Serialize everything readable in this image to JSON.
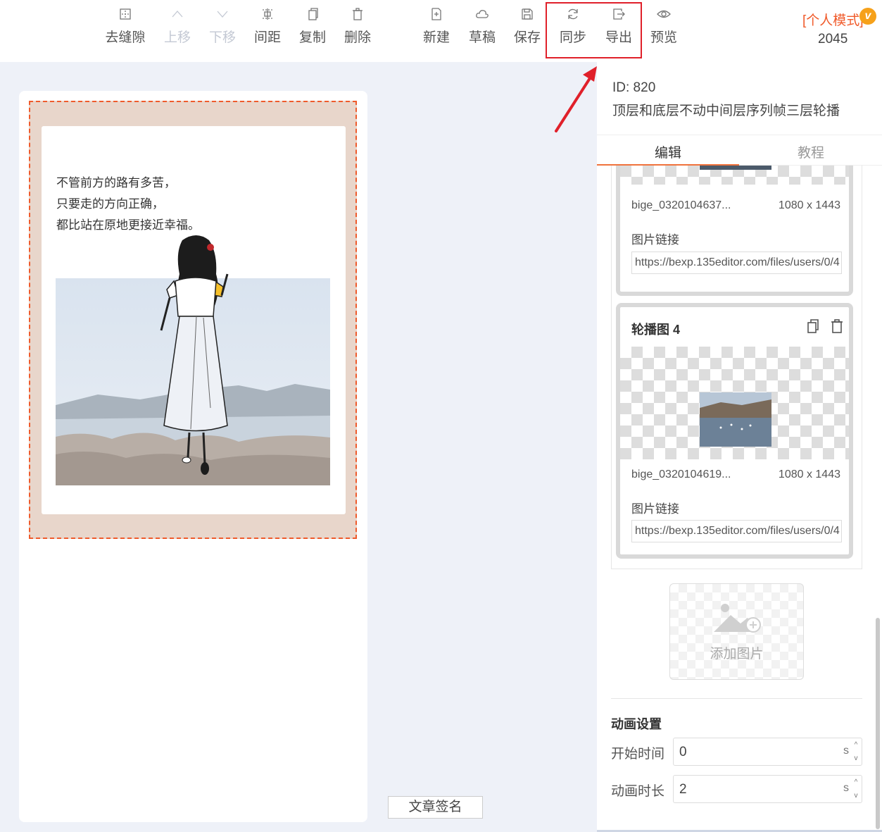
{
  "toolbar": {
    "items": [
      {
        "label": "去缝隙",
        "icon": "gap-icon",
        "disabled": false
      },
      {
        "label": "上移",
        "icon": "chevron-up-icon",
        "disabled": true
      },
      {
        "label": "下移",
        "icon": "chevron-down-icon",
        "disabled": true
      },
      {
        "label": "间距",
        "icon": "spacing-icon",
        "disabled": false
      },
      {
        "label": "复制",
        "icon": "copy-icon",
        "disabled": false
      },
      {
        "label": "删除",
        "icon": "trash-icon",
        "disabled": false
      },
      {
        "label": "新建",
        "icon": "new-file-icon",
        "disabled": false
      },
      {
        "label": "草稿",
        "icon": "cloud-icon",
        "disabled": false
      },
      {
        "label": "保存",
        "icon": "save-icon",
        "disabled": false
      },
      {
        "label": "同步",
        "icon": "sync-icon",
        "disabled": false
      },
      {
        "label": "导出",
        "icon": "export-icon",
        "disabled": false
      },
      {
        "label": "预览",
        "icon": "eye-icon",
        "disabled": false
      }
    ],
    "mode": "[个人模式]",
    "vip": "v",
    "count": "2045"
  },
  "canvas": {
    "poem": [
      "不管前方的路有多苦，",
      "只要走的方向正确，",
      "都比站在原地更接近幸福。"
    ],
    "sign_button": "文章签名"
  },
  "panel": {
    "id_text": "ID: 820",
    "name": "顶层和底层不动中间层序列帧三层轮播",
    "tabs": {
      "edit": "编辑",
      "tutorial": "教程"
    },
    "item3": {
      "file_name": "bige_0320104637...",
      "file_size": "1080 x 1443",
      "link_label": "图片链接",
      "link_value": "https://bexp.135editor.com/files/users/0/4"
    },
    "item4": {
      "title": "轮播图 4",
      "file_name": "bige_0320104619...",
      "file_size": "1080 x 1443",
      "link_label": "图片链接",
      "link_value": "https://bexp.135editor.com/files/users/0/4"
    },
    "add_image": "添加图片",
    "animation": {
      "title": "动画设置",
      "start_label": "开始时间",
      "start_value": "0",
      "duration_label": "动画时长",
      "duration_value": "2",
      "unit": "s"
    }
  },
  "colors": {
    "accent": "#f0723c",
    "highlight": "#e0202a",
    "frame_border": "#ef5b2c"
  }
}
